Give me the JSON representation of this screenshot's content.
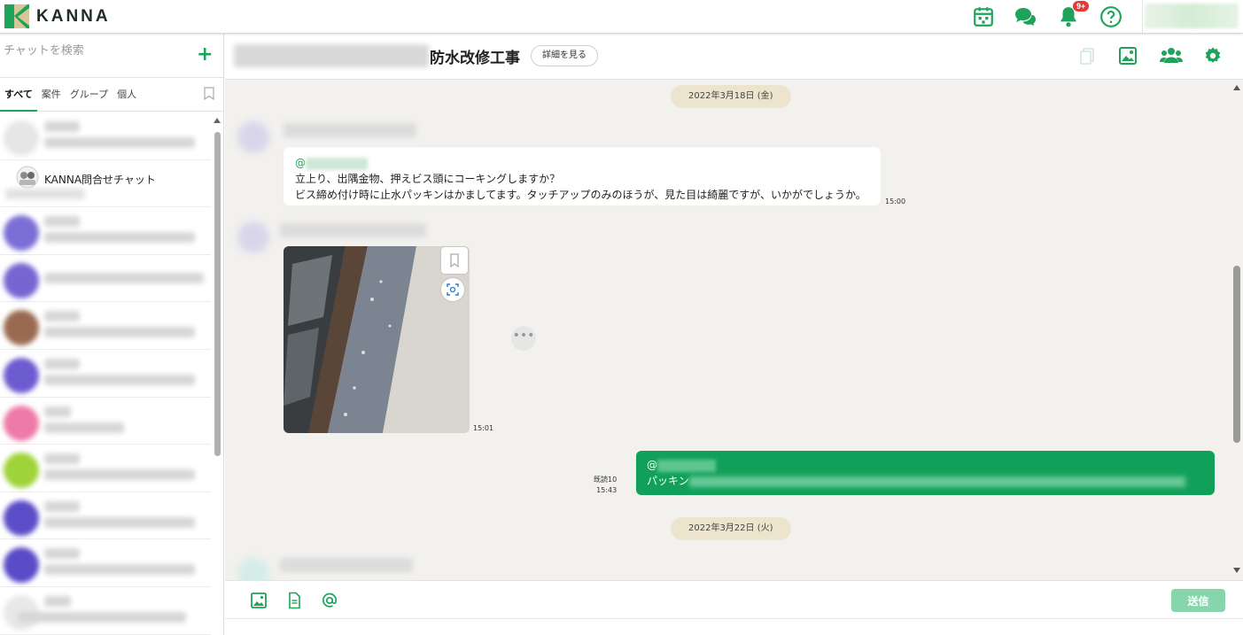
{
  "app": {
    "logo_text": "KANNA",
    "brand_color": "#1ea35a"
  },
  "topbar": {
    "notification_badge": "9+"
  },
  "sidebar": {
    "search_placeholder": "チャットを検索",
    "add_label": "+",
    "tabs": [
      {
        "label": "すべて",
        "active": true
      },
      {
        "label": "案件",
        "active": false
      },
      {
        "label": "グループ",
        "active": false
      },
      {
        "label": "個人",
        "active": false
      }
    ],
    "items": [
      {
        "name": "",
        "avatar_color": "#e8e8e8"
      },
      {
        "name": "KANNA問合せチャット",
        "avatar_color": "#e0e0e0"
      },
      {
        "name": "",
        "avatar_color": "#7b6fd6"
      },
      {
        "name": "",
        "avatar_color": "#7766d2"
      },
      {
        "name": "",
        "avatar_color": "#9a6a50"
      },
      {
        "name": "",
        "avatar_color": "#6d5cd0"
      },
      {
        "name": "",
        "avatar_color": "#ee7aa8"
      },
      {
        "name": "",
        "avatar_color": "#9fd33a"
      },
      {
        "name": "",
        "avatar_color": "#5b4cc8"
      },
      {
        "name": "",
        "avatar_color": "#5a4bc6"
      },
      {
        "name": "",
        "avatar_color": "#e8e8e8"
      }
    ]
  },
  "chat": {
    "title": "防水改修工事",
    "detail_button": "詳細を見る",
    "messages": {
      "date1": "2022年3月18日 (金)",
      "msg1_mention": "@",
      "msg1_line1": "立上り、出隅金物、押えビス頭にコーキングしますか？",
      "msg1_line2": "ビス締め付け時に止水パッキンはかましてます。タッチアップのみのほうが、見た目は綺麗ですが、いかがでしょうか。",
      "msg1_time": "15:00",
      "msg2_time": "15:01",
      "msg3_mention": "@",
      "msg3_text": "パッキン",
      "msg3_read": "既読10",
      "msg3_time": "15:43",
      "date2": "2022年3月22日 (火)"
    },
    "send_button": "送信"
  }
}
